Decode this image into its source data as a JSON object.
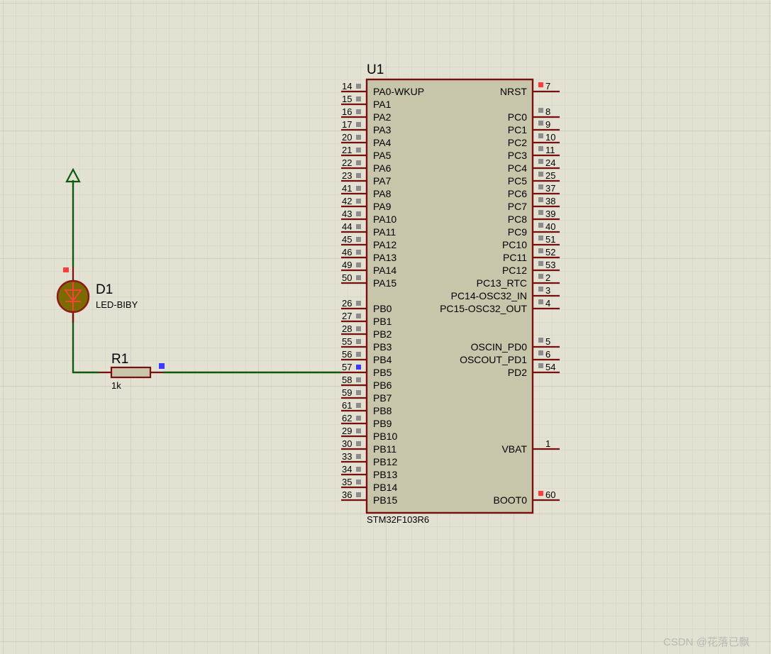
{
  "colors": {
    "background": "#e3e2d2",
    "grid_minor": "#d3d2c1",
    "grid_major": "#c8c7b6",
    "chip_body": "#c7c6ab",
    "chip_outline": "#7a0f0f",
    "wire": "#0d5a0d",
    "pin_marker_gray": "#8c8c8c",
    "pin_marker_red": "#ff3b3b",
    "pin_marker_blue": "#3a3aff",
    "led_fill": "#7a6a00"
  },
  "chip": {
    "ref": "U1",
    "part": "STM32F103R6",
    "left_pins": [
      {
        "num": "14",
        "name": "PA0-WKUP"
      },
      {
        "num": "15",
        "name": "PA1"
      },
      {
        "num": "16",
        "name": "PA2"
      },
      {
        "num": "17",
        "name": "PA3"
      },
      {
        "num": "20",
        "name": "PA4"
      },
      {
        "num": "21",
        "name": "PA5"
      },
      {
        "num": "22",
        "name": "PA6"
      },
      {
        "num": "23",
        "name": "PA7"
      },
      {
        "num": "41",
        "name": "PA8"
      },
      {
        "num": "42",
        "name": "PA9"
      },
      {
        "num": "43",
        "name": "PA10"
      },
      {
        "num": "44",
        "name": "PA11"
      },
      {
        "num": "45",
        "name": "PA12"
      },
      {
        "num": "46",
        "name": "PA13"
      },
      {
        "num": "49",
        "name": "PA14"
      },
      {
        "num": "50",
        "name": "PA15"
      },
      {
        "num": "26",
        "name": "PB0"
      },
      {
        "num": "27",
        "name": "PB1"
      },
      {
        "num": "28",
        "name": "PB2"
      },
      {
        "num": "55",
        "name": "PB3"
      },
      {
        "num": "56",
        "name": "PB4"
      },
      {
        "num": "57",
        "name": "PB5"
      },
      {
        "num": "58",
        "name": "PB6"
      },
      {
        "num": "59",
        "name": "PB7"
      },
      {
        "num": "61",
        "name": "PB8"
      },
      {
        "num": "62",
        "name": "PB9"
      },
      {
        "num": "29",
        "name": "PB10"
      },
      {
        "num": "30",
        "name": "PB11"
      },
      {
        "num": "33",
        "name": "PB12"
      },
      {
        "num": "34",
        "name": "PB13"
      },
      {
        "num": "35",
        "name": "PB14"
      },
      {
        "num": "36",
        "name": "PB15"
      }
    ],
    "right_pins": [
      {
        "num": "7",
        "name": "NRST"
      },
      {
        "num": "8",
        "name": "PC0"
      },
      {
        "num": "9",
        "name": "PC1"
      },
      {
        "num": "10",
        "name": "PC2"
      },
      {
        "num": "11",
        "name": "PC3"
      },
      {
        "num": "24",
        "name": "PC4"
      },
      {
        "num": "25",
        "name": "PC5"
      },
      {
        "num": "37",
        "name": "PC6"
      },
      {
        "num": "38",
        "name": "PC7"
      },
      {
        "num": "39",
        "name": "PC8"
      },
      {
        "num": "40",
        "name": "PC9"
      },
      {
        "num": "51",
        "name": "PC10"
      },
      {
        "num": "52",
        "name": "PC11"
      },
      {
        "num": "53",
        "name": "PC12"
      },
      {
        "num": "2",
        "name": "PC13_RTC"
      },
      {
        "num": "3",
        "name": "PC14-OSC32_IN"
      },
      {
        "num": "4",
        "name": "PC15-OSC32_OUT"
      },
      {
        "num": "5",
        "name": "OSCIN_PD0"
      },
      {
        "num": "6",
        "name": "OSCOUT_PD1"
      },
      {
        "num": "54",
        "name": "PD2"
      },
      {
        "num": "1",
        "name": "VBAT"
      },
      {
        "num": "60",
        "name": "BOOT0"
      }
    ]
  },
  "led": {
    "ref": "D1",
    "part": "LED-BIBY"
  },
  "resistor": {
    "ref": "R1",
    "value": "1k"
  },
  "watermark": "CSDN @花落已飘"
}
